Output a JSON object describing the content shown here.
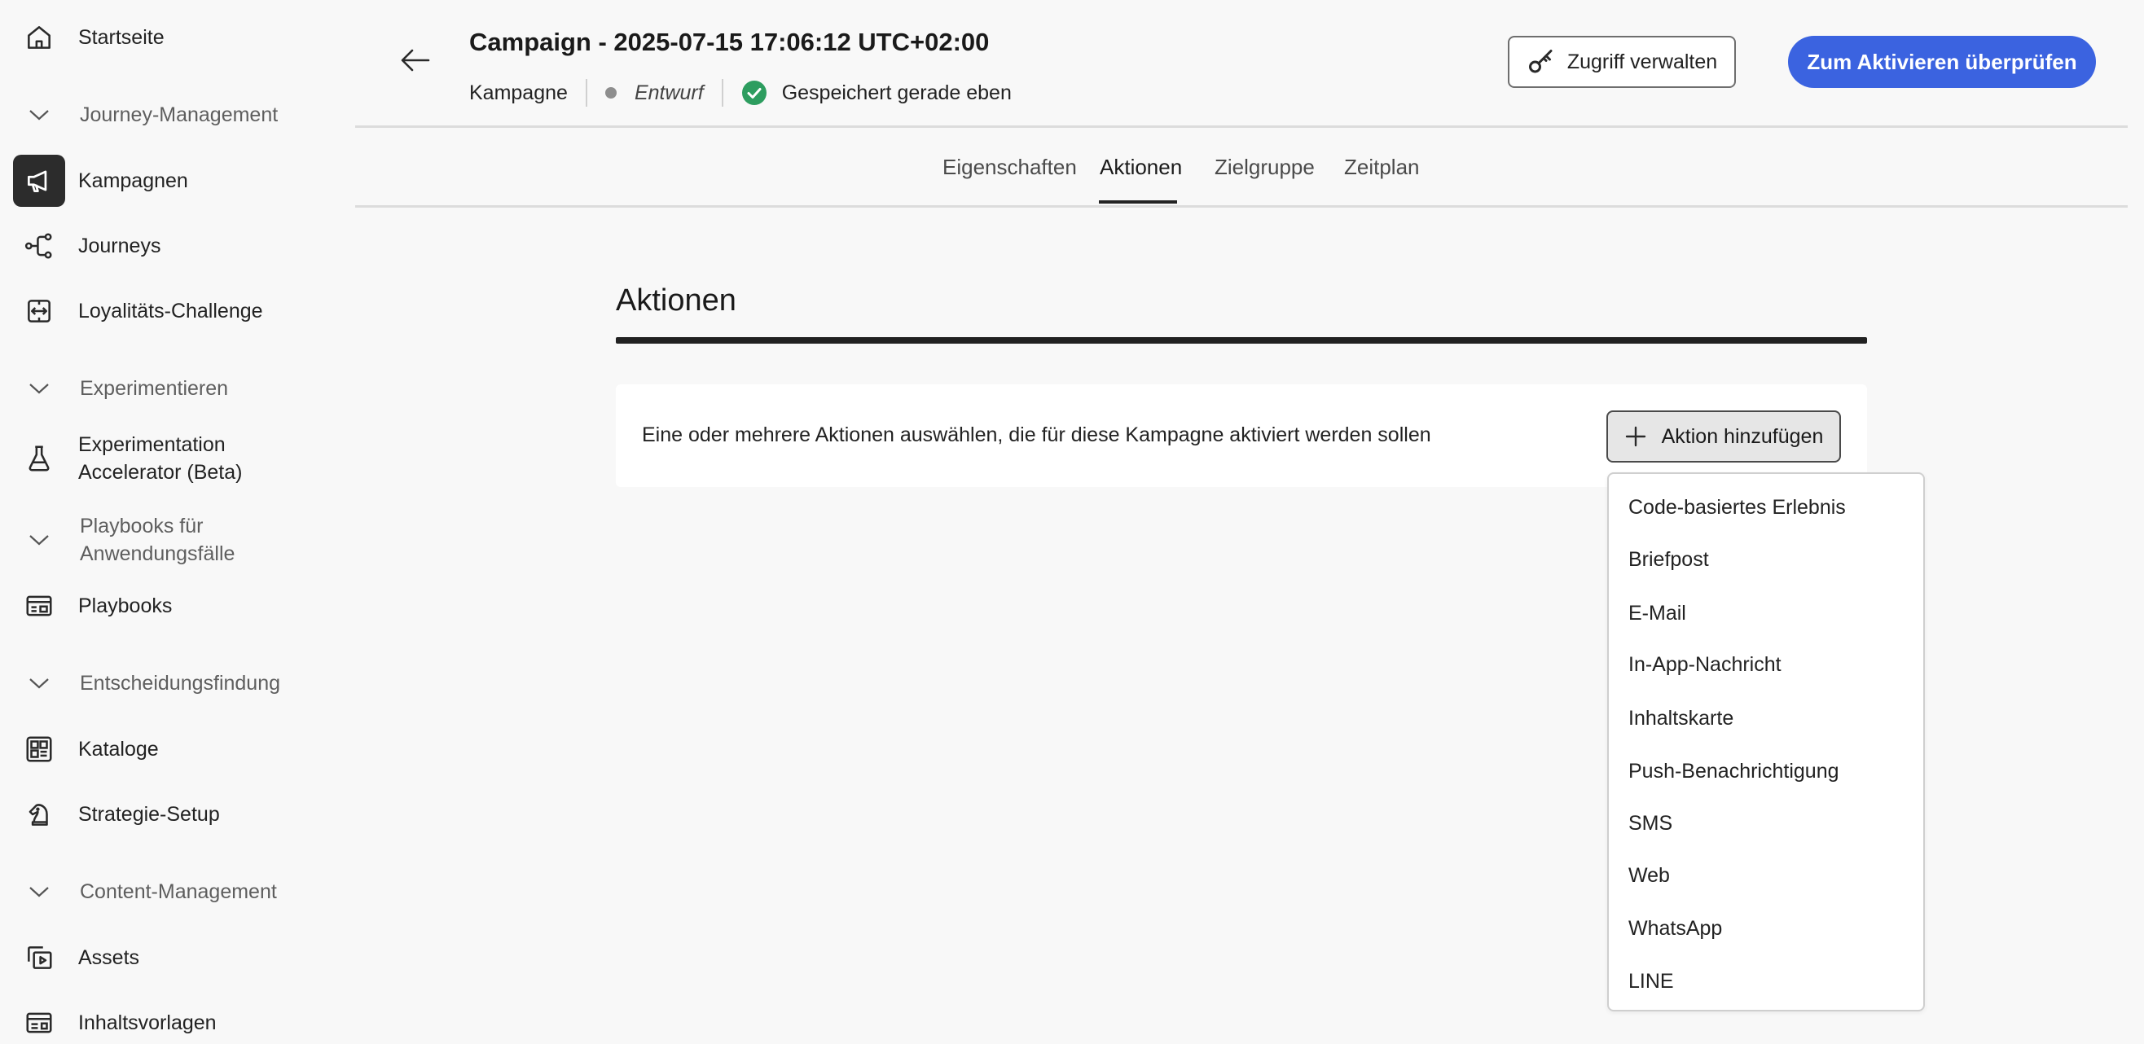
{
  "sidebar": {
    "home": "Startseite",
    "sections": {
      "journey_management": "Journey-Management",
      "experimentation": "Experimentieren",
      "playbooks": "Playbooks für Anwendungsfälle",
      "decisioning": "Entscheidungsfindung",
      "content_management": "Content-Management"
    },
    "items": {
      "campaigns": "Kampagnen",
      "journeys": "Journeys",
      "loyalty": "Loyalitäts-Challenge",
      "exp_accel_line1": "Experimentation",
      "exp_accel_line2": "Accelerator (Beta)",
      "playbooks": "Playbooks",
      "catalogs": "Kataloge",
      "strategy": "Strategie-Setup",
      "assets": "Assets",
      "templates": "Inhaltsvorlagen"
    },
    "playbooks_section_line1": "Playbooks für",
    "playbooks_section_line2": "Anwendungsfälle"
  },
  "header": {
    "title": "Campaign - 2025-07-15 17:06:12 UTC+02:00",
    "type": "Kampagne",
    "status": "Entwurf",
    "saved": "Gespeichert gerade eben",
    "access_button": "Zugriff verwalten",
    "primary_button": "Zum Aktivieren überprüfen"
  },
  "tabs": [
    "Eigenschaften",
    "Aktionen",
    "Zielgruppe",
    "Zeitplan"
  ],
  "main": {
    "section_title": "Aktionen",
    "card_text": "Eine oder mehrere Aktionen auswählen, die für diese Kampagne aktiviert werden sollen",
    "add_button": "Aktion hinzufügen"
  },
  "menu": {
    "items": [
      "Code-basiertes Erlebnis",
      "Briefpost",
      "E-Mail",
      "In-App-Nachricht",
      "Inhaltskarte",
      "Push-Benachrichtigung",
      "SMS",
      "Web",
      "WhatsApp",
      "LINE"
    ]
  },
  "colors": {
    "accent": "#3b63e0",
    "active_nav_bg": "#2c2c2c",
    "success": "#2d9d5f"
  }
}
